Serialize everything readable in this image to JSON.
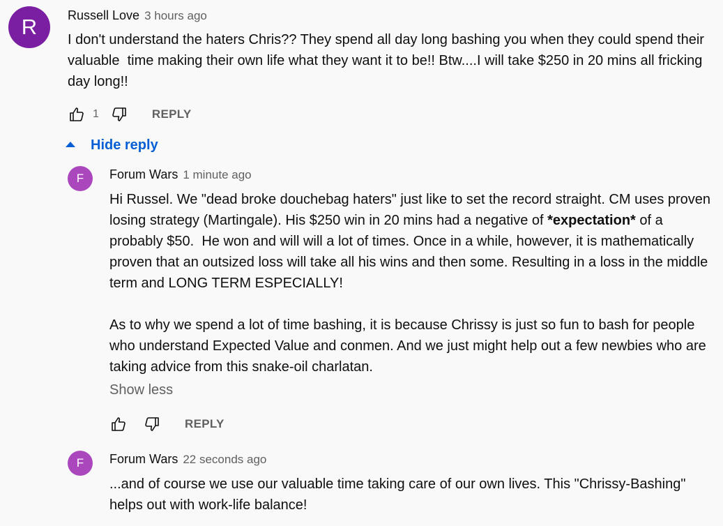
{
  "comments": [
    {
      "avatar_letter": "R",
      "author": "Russell Love",
      "time": "3 hours ago",
      "text": "I don't understand the haters Chris?? They spend all day long bashing you when they could spend their valuable  time making their own life what they want it to be!! Btw....I will take $250 in 20 mins all fricking day long!!",
      "likes": "1",
      "reply_label": "REPLY"
    }
  ],
  "hide_reply_label": "Hide reply",
  "replies": [
    {
      "avatar_letter": "F",
      "author": "Forum Wars",
      "time": "1 minute ago",
      "text_part1": "Hi Russel. We \"dead broke douchebag haters\" just like to set the record straight. CM uses proven losing strategy (Martingale). His $250 win in 20 mins had a negative of ",
      "text_bold": "*expectation*",
      "text_part2": " of a probably $50.  He won and will will a lot of times. Once in a while, however, it is mathematically proven that an outsized loss will take all his wins and then some. Resulting in a loss in the middle term and LONG TERM ESPECIALLY!\n\nAs to why we spend a lot of time bashing, it is because Chrissy is just so fun to bash for people who understand Expected Value and conmen. And we just might help out a few newbies who are taking advice from this snake-oil charlatan.",
      "show_less_label": "Show less",
      "reply_label": "REPLY"
    },
    {
      "avatar_letter": "F",
      "author": "Forum Wars",
      "time": "22 seconds ago",
      "text": "...and of course we use our valuable time taking care of our own lives. This \"Chrissy-Bashing\" helps out with work-life balance!"
    }
  ],
  "icons": {
    "like": "thumbs-up-icon",
    "dislike": "thumbs-down-icon",
    "collapse": "triangle-up-icon"
  },
  "colors": {
    "link_blue": "#065fd4",
    "secondary_text": "#606060",
    "avatar_russell": "#7b1fa2",
    "avatar_forum": "#ab47bc"
  }
}
